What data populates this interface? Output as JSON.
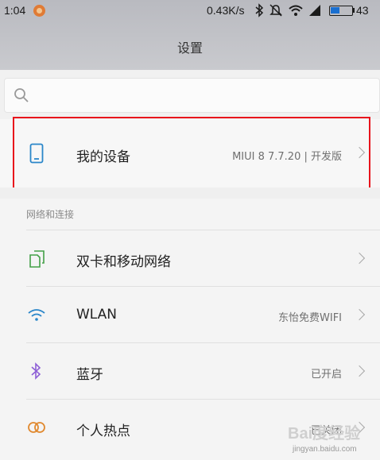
{
  "status_bar": {
    "time": "1:04",
    "speed": "0.43K/s",
    "battery_percent": "43",
    "battery_level": 0.43,
    "icons": [
      "app-notification-icon",
      "bluetooth-icon",
      "mute-icon",
      "wifi-icon",
      "signal-icon",
      "battery-icon"
    ]
  },
  "header": {
    "title": "设置"
  },
  "search": {
    "placeholder": ""
  },
  "device": {
    "label": "我的设备",
    "value": "MIUI 8 7.7.20 | 开发版",
    "icon": "phone-icon"
  },
  "section": {
    "title": "网络和连接",
    "items": [
      {
        "label": "双卡和移动网络",
        "value": "",
        "icon": "dual-sim-icon"
      },
      {
        "label": "WLAN",
        "value": "东怡免费WIFI",
        "icon": "wifi-icon"
      },
      {
        "label": "蓝牙",
        "value": "已开启",
        "icon": "bluetooth-icon"
      },
      {
        "label": "个人热点",
        "value": "已关闭",
        "icon": "hotspot-icon"
      }
    ]
  },
  "colors": {
    "highlight": "#e8141c",
    "accent_icon": "#2a86c9",
    "header_bg": "#c2c3c8"
  },
  "watermark": {
    "brand": "Bai度经验",
    "url": "jingyan.baidu.com"
  }
}
